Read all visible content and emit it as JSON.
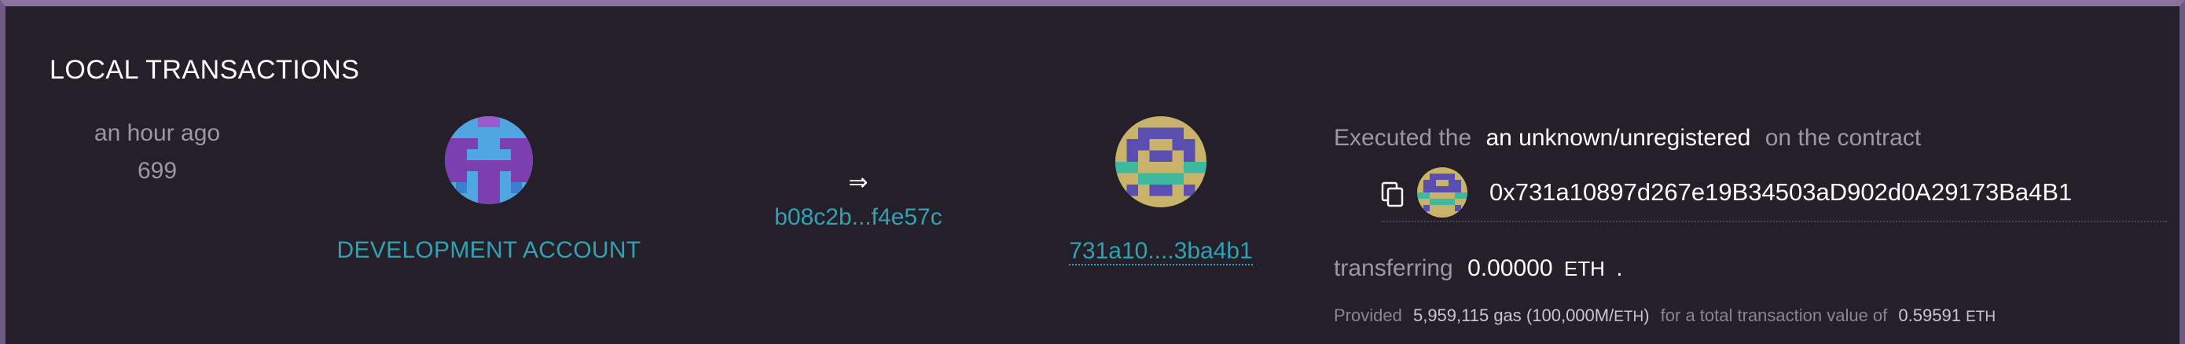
{
  "section_title": "LOCAL TRANSACTIONS",
  "transaction": {
    "time_ago": "an hour ago",
    "block_number": "699",
    "from": {
      "label": "DEVELOPMENT ACCOUNT",
      "avatar_icon": "identicon-blue-purple"
    },
    "arrow": "⇒",
    "tx_hash_short": "b08c2b...f4e57c",
    "to": {
      "address_short": "731a10....3ba4b1",
      "avatar_icon": "identicon-olive-blue"
    },
    "details": {
      "executed_prefix": "Executed the",
      "method": "an unknown/unregistered",
      "executed_suffix": "on the contract",
      "contract_address": "0x731a10897d267e19B34503aD902d0A29173Ba4B1",
      "copy_icon": "copy-icon",
      "transferring_label": "transferring",
      "amount": "0.00000",
      "amount_unit": "ETH",
      "amount_end": ".",
      "provided_label": "Provided",
      "gas_amount": "5,959,115 gas",
      "gas_price_open": "(100,000M/",
      "gas_price_unit": "ETH",
      "gas_price_close": ")",
      "total_label": "for a total transaction value of",
      "total_value": "0.59591",
      "total_unit": "ETH"
    }
  },
  "colors": {
    "background": "#241f29",
    "border": "#8a729f",
    "link": "#2fa3b5",
    "muted_text": "#9c98a2",
    "highlight_text": "#ffffff"
  }
}
